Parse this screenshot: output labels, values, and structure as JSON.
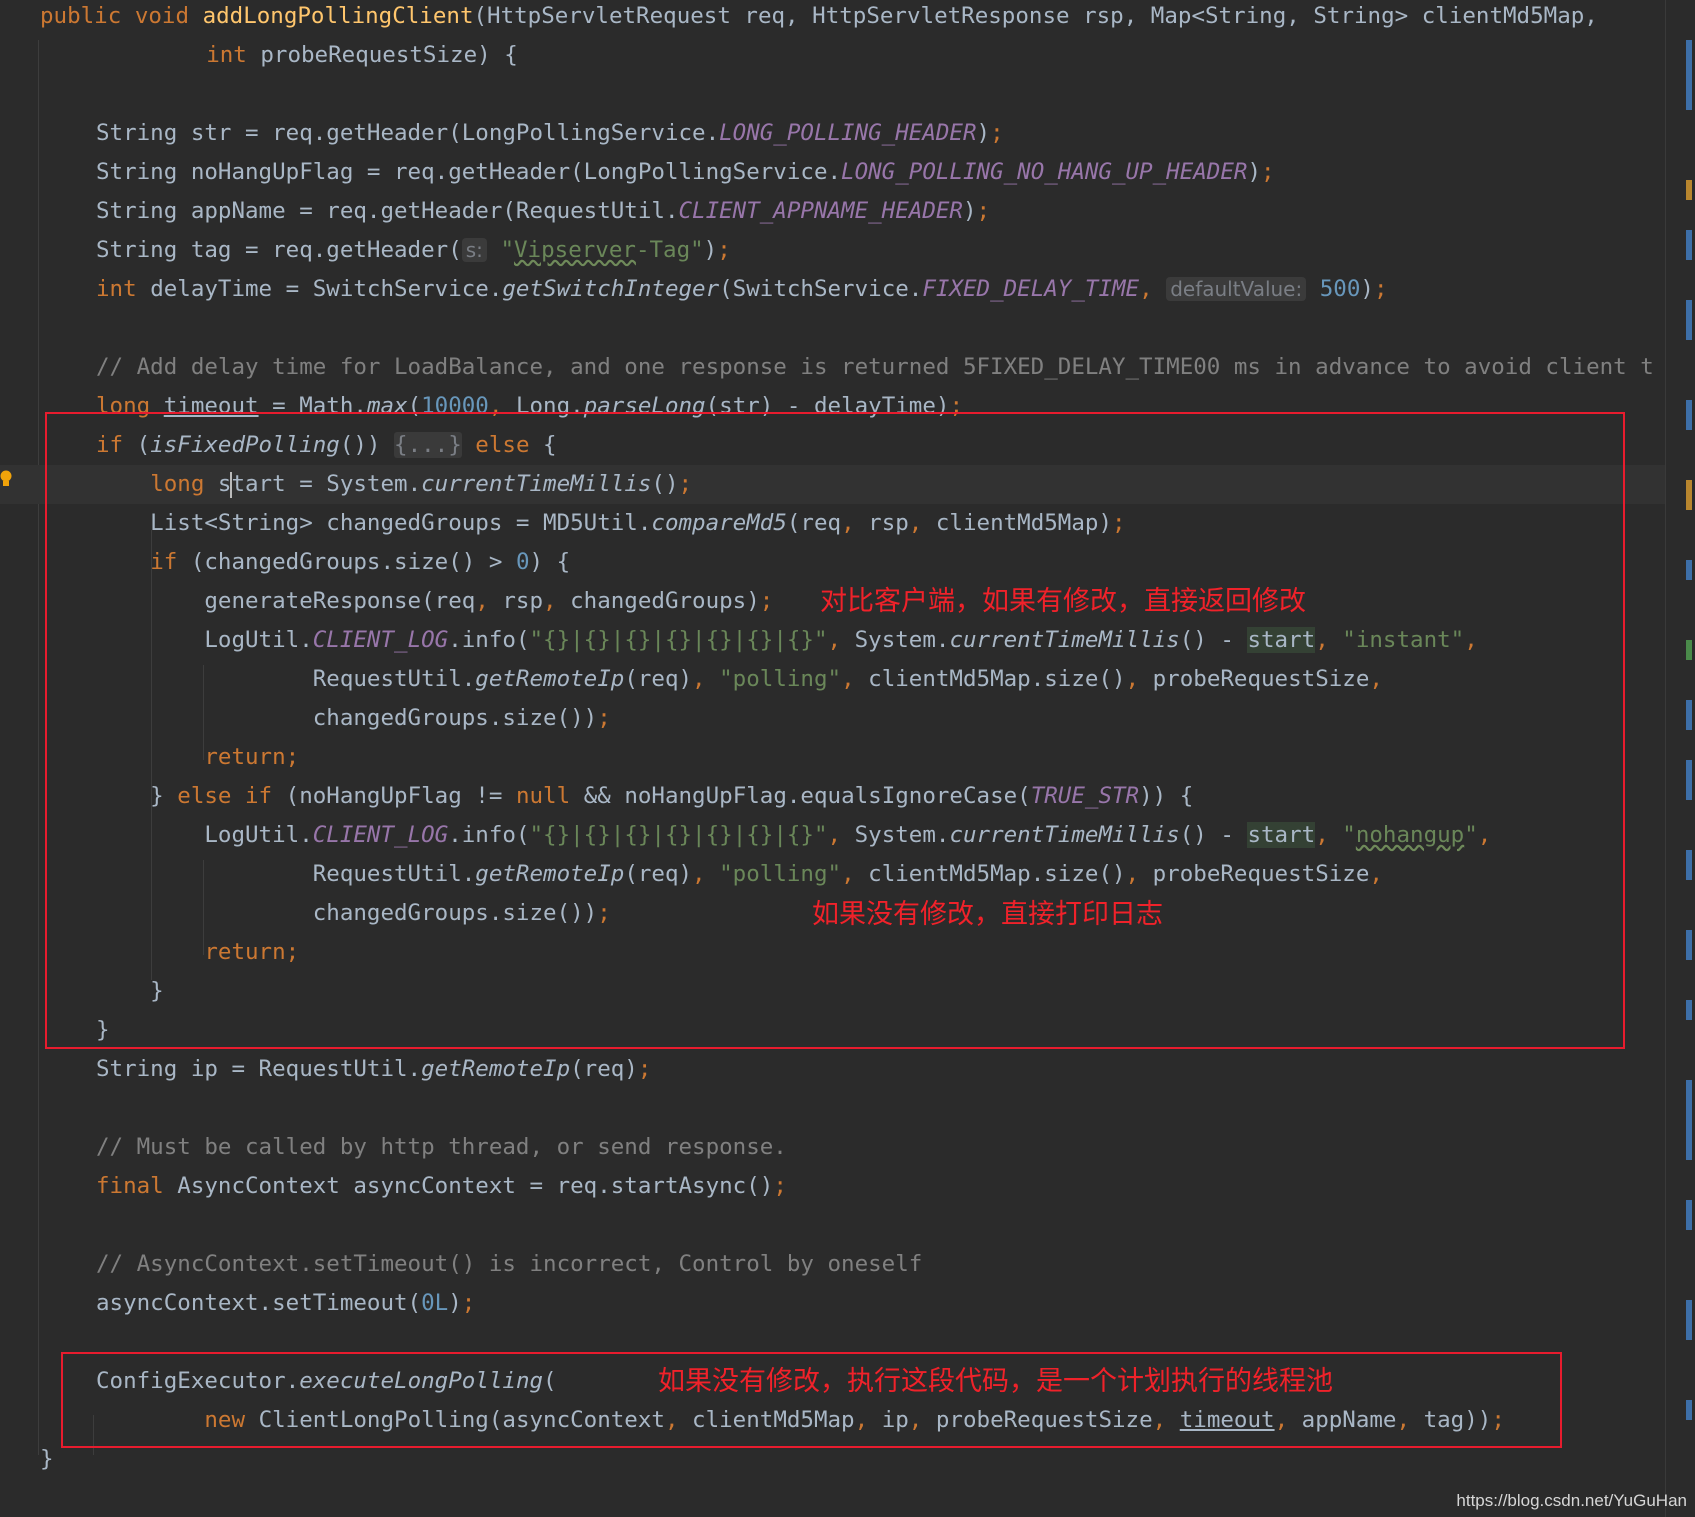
{
  "editor": {
    "lines": [
      [
        [
          "kw",
          "public void "
        ],
        [
          "fn",
          "addLongPollingClient"
        ],
        [
          "",
          "(HttpServletRequest req, HttpServletResponse rsp, Map<String, String> clientMd5Map,"
        ]
      ],
      [
        [
          "",
          "    "
        ],
        [
          "kw",
          "int "
        ],
        [
          "",
          "probeRequestSize) {"
        ]
      ],
      [],
      [
        [
          "",
          "String str = req.getHeader(LongPollingService."
        ],
        [
          "st",
          "LONG_POLLING_HEADER"
        ],
        [
          "",
          ")"
        ],
        [
          "kw",
          ";"
        ]
      ],
      [
        [
          "",
          "String noHangUpFlag = req.getHeader(LongPollingService."
        ],
        [
          "st",
          "LONG_POLLING_NO_HANG_UP_HEADER"
        ],
        [
          "",
          ")"
        ],
        [
          "kw",
          ";"
        ]
      ],
      [
        [
          "",
          "String appName = req.getHeader(RequestUtil."
        ],
        [
          "st",
          "CLIENT_APPNAME_HEADER"
        ],
        [
          "",
          ")"
        ],
        [
          "kw",
          ";"
        ]
      ],
      [
        [
          "",
          "String tag = req.getHeader("
        ],
        [
          "hint",
          "s:"
        ],
        [
          "str",
          " \""
        ],
        [
          "str wavy",
          "Vipserver"
        ],
        [
          "str",
          "-Tag\""
        ],
        [
          "",
          ")"
        ],
        [
          "kw",
          ";"
        ]
      ],
      [
        [
          "kw",
          "int "
        ],
        [
          "",
          "delayTime = SwitchService."
        ],
        [
          "it",
          "getSwitchInteger"
        ],
        [
          "",
          "(SwitchService."
        ],
        [
          "st",
          "FIXED_DELAY_TIME"
        ],
        [
          "kw",
          ", "
        ],
        [
          "hint",
          "defaultValue:"
        ],
        [
          "num",
          " 500"
        ],
        [
          "",
          ")"
        ],
        [
          "kw",
          ";"
        ]
      ],
      [],
      [
        [
          "cm",
          "// Add delay time for LoadBalance, and one response is returned 5FIXED_DELAY_TIME00 ms in advance to avoid client t"
        ]
      ],
      [
        [
          "kw",
          "long "
        ],
        [
          "ul",
          "timeout"
        ],
        [
          "",
          " = Math."
        ],
        [
          "it",
          "max"
        ],
        [
          "",
          "("
        ],
        [
          "num",
          "10000"
        ],
        [
          "kw",
          ", "
        ],
        [
          "",
          "Long."
        ],
        [
          "it",
          "parseLong"
        ],
        [
          "",
          "(str) - delayTime)"
        ],
        [
          "kw",
          ";"
        ]
      ],
      [
        [
          "kw",
          "if "
        ],
        [
          "",
          "("
        ],
        [
          "it",
          "isFixedPolling"
        ],
        [
          "",
          "()) "
        ],
        [
          "fold",
          "{...}"
        ],
        [
          "kw",
          " else "
        ],
        [
          "",
          "{"
        ]
      ],
      [
        [
          "",
          "    "
        ],
        [
          "kw",
          "long "
        ],
        [
          "",
          "s"
        ],
        [
          "caret",
          ""
        ],
        [
          "",
          "tart = System."
        ],
        [
          "it",
          "currentTimeMillis"
        ],
        [
          "",
          "()"
        ],
        [
          "kw",
          ";"
        ]
      ],
      [
        [
          "",
          "    List<String> changedGroups = MD5Util."
        ],
        [
          "it",
          "compareMd5"
        ],
        [
          "",
          "(req"
        ],
        [
          "kw",
          ", "
        ],
        [
          "",
          "rsp"
        ],
        [
          "kw",
          ", "
        ],
        [
          "",
          "clientMd5Map)"
        ],
        [
          "kw",
          ";"
        ]
      ],
      [
        [
          "",
          "    "
        ],
        [
          "kw",
          "if "
        ],
        [
          "",
          "(changedGroups.size() > "
        ],
        [
          "num",
          "0"
        ],
        [
          "",
          ") {"
        ]
      ],
      [
        [
          "",
          "        generateResponse(req"
        ],
        [
          "kw",
          ", "
        ],
        [
          "",
          "rsp"
        ],
        [
          "kw",
          ", "
        ],
        [
          "",
          "changedGroups)"
        ],
        [
          "kw",
          ";"
        ]
      ],
      [
        [
          "",
          "        LogUtil."
        ],
        [
          "st",
          "CLIENT_LOG"
        ],
        [
          "",
          ".info("
        ],
        [
          "str",
          "\"{}|{}|{}|{}|{}|{}|{}\""
        ],
        [
          "kw",
          ", "
        ],
        [
          "",
          "System."
        ],
        [
          "it",
          "currentTimeMillis"
        ],
        [
          "",
          "() - "
        ],
        [
          "hl",
          "start"
        ],
        [
          "kw",
          ", "
        ],
        [
          "str",
          "\"instant\""
        ],
        [
          "kw",
          ","
        ]
      ],
      [
        [
          "",
          "                RequestUtil."
        ],
        [
          "it",
          "getRemoteIp"
        ],
        [
          "",
          "(req)"
        ],
        [
          "kw",
          ", "
        ],
        [
          "str",
          "\"polling\""
        ],
        [
          "kw",
          ", "
        ],
        [
          "",
          "clientMd5Map.size()"
        ],
        [
          "kw",
          ", "
        ],
        [
          "",
          "probeRequestSize"
        ],
        [
          "kw",
          ","
        ]
      ],
      [
        [
          "",
          "                changedGroups.size())"
        ],
        [
          "kw",
          ";"
        ]
      ],
      [
        [
          "",
          "        "
        ],
        [
          "kw",
          "return;"
        ]
      ],
      [
        [
          "",
          "    } "
        ],
        [
          "kw",
          "else if "
        ],
        [
          "",
          "(noHangUpFlag != "
        ],
        [
          "kw",
          "null "
        ],
        [
          "",
          "&& noHangUpFlag.equalsIgnoreCase("
        ],
        [
          "st",
          "TRUE_STR"
        ],
        [
          "",
          ")) {"
        ]
      ],
      [
        [
          "",
          "        LogUtil."
        ],
        [
          "st",
          "CLIENT_LOG"
        ],
        [
          "",
          ".info("
        ],
        [
          "str",
          "\"{}|{}|{}|{}|{}|{}|{}\""
        ],
        [
          "kw",
          ", "
        ],
        [
          "",
          "System."
        ],
        [
          "it",
          "currentTimeMillis"
        ],
        [
          "",
          "() - "
        ],
        [
          "hl",
          "start"
        ],
        [
          "kw",
          ", "
        ],
        [
          "str",
          "\""
        ],
        [
          "str wavy",
          "nohangup"
        ],
        [
          "str",
          "\""
        ],
        [
          "kw",
          ","
        ]
      ],
      [
        [
          "",
          "                RequestUtil."
        ],
        [
          "it",
          "getRemoteIp"
        ],
        [
          "",
          "(req)"
        ],
        [
          "kw",
          ", "
        ],
        [
          "str",
          "\"polling\""
        ],
        [
          "kw",
          ", "
        ],
        [
          "",
          "clientMd5Map.size()"
        ],
        [
          "kw",
          ", "
        ],
        [
          "",
          "probeRequestSize"
        ],
        [
          "kw",
          ","
        ]
      ],
      [
        [
          "",
          "                changedGroups.size())"
        ],
        [
          "kw",
          ";"
        ]
      ],
      [
        [
          "",
          "        "
        ],
        [
          "kw",
          "return;"
        ]
      ],
      [
        [
          "",
          "    }"
        ]
      ],
      [
        [
          "",
          "}"
        ]
      ],
      [
        [
          "",
          "String ip = RequestUtil."
        ],
        [
          "it",
          "getRemoteIp"
        ],
        [
          "",
          "(req)"
        ],
        [
          "kw",
          ";"
        ]
      ],
      [],
      [
        [
          "cm",
          "// Must be called by http thread, or send response."
        ]
      ],
      [
        [
          "kw",
          "final "
        ],
        [
          "",
          "AsyncContext asyncContext = req.startAsync()"
        ],
        [
          "kw",
          ";"
        ]
      ],
      [],
      [
        [
          "cm",
          "// AsyncContext.setTimeout() is incorrect, Control by oneself"
        ]
      ],
      [
        [
          "",
          "asyncContext.setTimeout("
        ],
        [
          "num",
          "0L"
        ],
        [
          "",
          ")"
        ],
        [
          "kw",
          ";"
        ]
      ],
      [],
      [
        [
          "",
          "ConfigExecutor."
        ],
        [
          "it",
          "executeLongPolling"
        ],
        [
          "",
          "("
        ]
      ],
      [
        [
          "",
          "        "
        ],
        [
          "kw",
          "new "
        ],
        [
          "",
          "ClientLongPolling(asyncContext"
        ],
        [
          "kw",
          ", "
        ],
        [
          "",
          "clientMd5Map"
        ],
        [
          "kw",
          ", "
        ],
        [
          "",
          "ip"
        ],
        [
          "kw",
          ", "
        ],
        [
          "",
          "probeRequestSize"
        ],
        [
          "kw",
          ", "
        ],
        [
          "ul",
          "timeout"
        ],
        [
          "kw",
          ", "
        ],
        [
          "",
          "appName"
        ],
        [
          "kw",
          ", "
        ],
        [
          "",
          "tag))"
        ],
        [
          "kw",
          ";"
        ]
      ],
      [
        [
          "",
          "}"
        ]
      ]
    ]
  },
  "annotations": {
    "note_1": "对比客户端，如果有修改，直接返回修改",
    "note_2": "如果没有修改，直接打印日志",
    "note_3": "如果没有修改，执行这段代码，是一个计划执行的线程池"
  },
  "watermark": "https://blog.csdn.net/YuGuHan",
  "colors": {
    "background": "#2b2b2b",
    "keyword": "#cc7832",
    "function_decl": "#ffc66d",
    "static_field": "#9876aa",
    "string": "#6a8759",
    "number": "#6897bb",
    "comment": "#808080",
    "annotation_red": "#e81c2e"
  }
}
